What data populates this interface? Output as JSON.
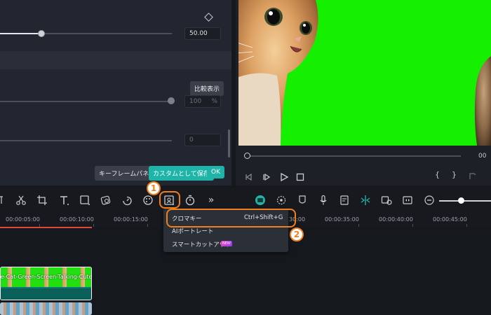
{
  "properties": {
    "slider1_value": "50.00",
    "compare_button": "比較表示",
    "slider2_value": "100",
    "slider2_unit": "%",
    "slider3_value": "0",
    "keyframe_button": "キーフレームパネル",
    "save_custom_button": "カスタムとして保存",
    "ok_button": "OK"
  },
  "preview": {
    "time_partial": "00"
  },
  "ruler": {
    "ticks": [
      "00:00:05:00",
      "00:00:10:00",
      "00:00:15:00",
      "00:00:35:00",
      "00:00:40:00",
      "00:00:45:00"
    ],
    "partial_tick": "30:00"
  },
  "menu": {
    "items": [
      {
        "label": "クロマキー",
        "shortcut": "Ctrl+Shift+G"
      },
      {
        "label": "AIポートレート"
      },
      {
        "label": "スマートカットアウト",
        "badge": "NEW"
      }
    ]
  },
  "timeline": {
    "clip_label": "Cute-Cat-Green-Screen-Talking-Cute..."
  },
  "callouts": {
    "step1": "1",
    "step2": "2",
    "color": "#f07f1e"
  },
  "colors": {
    "accent": "#1fb4a8",
    "green_screen": "#14f000",
    "playhead": "#e0473a"
  }
}
